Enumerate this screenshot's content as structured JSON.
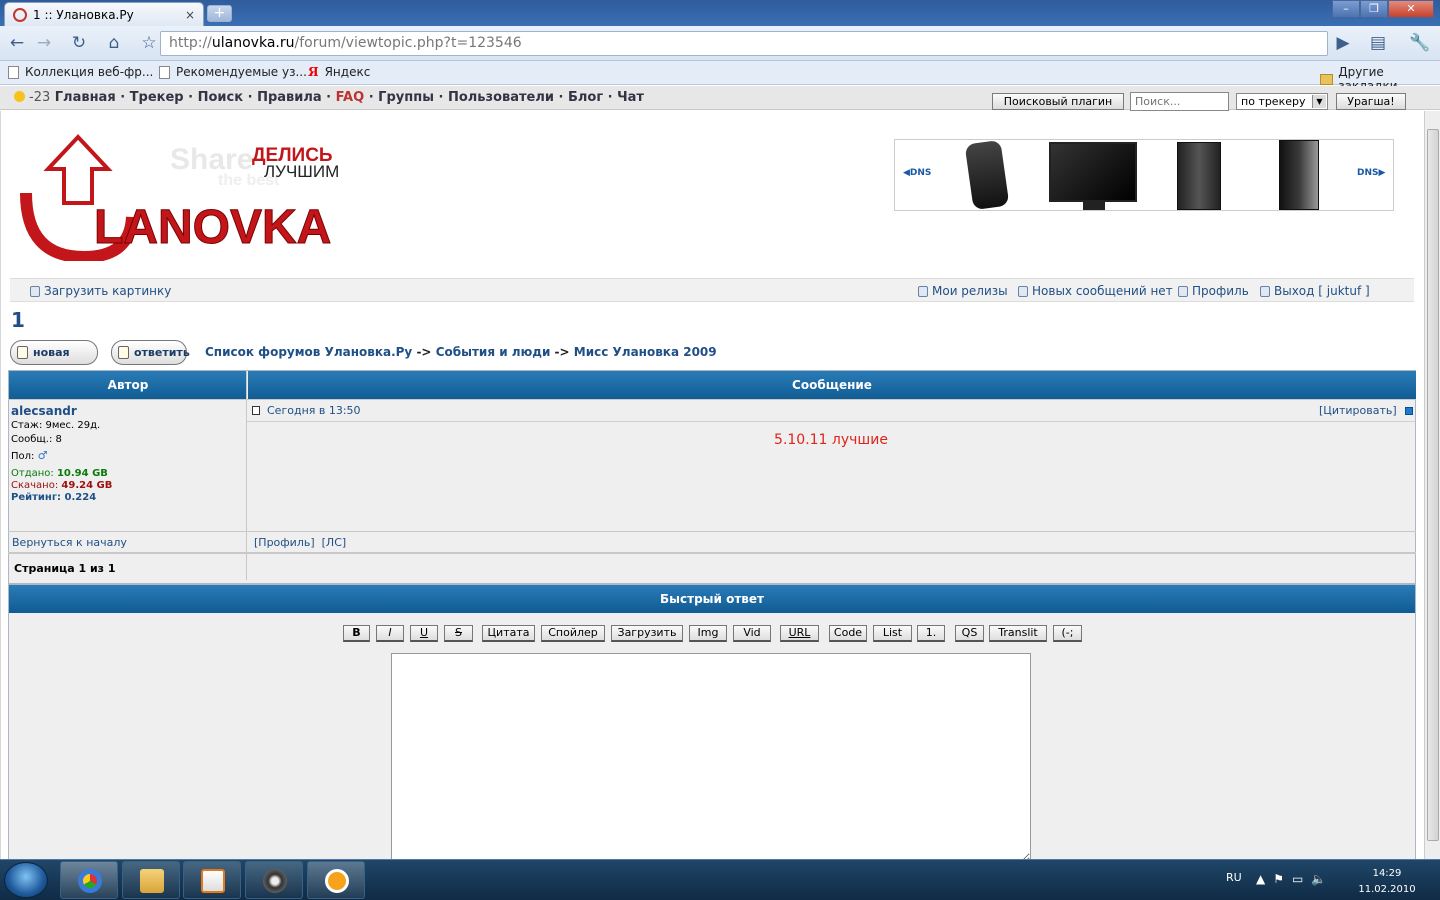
{
  "browser": {
    "tab_title": "1 :: Улановка.Ру",
    "tab_close": "×",
    "new_tab": "+",
    "url_base": "http://",
    "url_domain": "ulanovka.ru",
    "url_path": "/forum/viewtopic.php?t=123546",
    "bookmarks": [
      "Коллекция веб-фр...",
      "Рекомендуемые уз...",
      "Яндекс"
    ],
    "other_bookmarks": "Другие закладки"
  },
  "site_nav": {
    "temperature": "-23",
    "links": [
      "Главная",
      "Трекер",
      "Поиск",
      "Правила",
      "FAQ",
      "Группы",
      "Пользователи",
      "Блог",
      "Чат"
    ],
    "search_plugin_label": "Поисковый плагин",
    "search_placeholder": "Поиск...",
    "search_scope": "по трекеру",
    "search_button": "Урагша!"
  },
  "logo": {
    "tagline_top": "ДЕЛИСЬ",
    "tagline_bottom": "ЛУЧШИМ",
    "share_text": "Share",
    "share_sub": "the best",
    "brand_u": "U",
    "brand_rest": "LANOVKA"
  },
  "banner": {
    "brand": "DNS"
  },
  "user_bar": {
    "upload": "Загрузить картинку",
    "my_releases": "Мои релизы",
    "no_new_messages": "Новых сообщений нет",
    "profile": "Профиль",
    "logout": "Выход [ juktuf ]"
  },
  "topic": {
    "title": "1",
    "new_topic_btn": "новая тема",
    "reply_btn": "ответить",
    "breadcrumb": [
      "Список форумов Улановка.Ру",
      "События и люди",
      "Мисс Улановка 2009"
    ],
    "breadcrumb_sep": "->"
  },
  "table": {
    "col_author": "Автор",
    "col_message": "Сообщение"
  },
  "post": {
    "author": "alecsandr",
    "stazh": "Стаж: 9мес. 29д.",
    "messages": "Сообщ.: 8",
    "gender_label": "Пол:",
    "given_label": "Отдано:",
    "given_value": "10.94 GB",
    "downloaded_label": "Скачано:",
    "downloaded_value": "49.24 GB",
    "rating": "Рейтинг: 0.224",
    "date": "Сегодня в 13:50",
    "quote": "[Цитировать]",
    "text": "5.10.11 лучшие",
    "back_to_top": "Вернуться к началу",
    "profile_link": "[Профиль]",
    "pm_link": "[ЛС]"
  },
  "pagination": "Страница 1 из 1",
  "quick_reply": {
    "title": "Быстрый ответ",
    "buttons": [
      "B",
      "I",
      "U",
      "S",
      "Цитата",
      "Спойлер",
      "Загрузить",
      "Img",
      "Vid",
      "URL",
      "Code",
      "List",
      "1.",
      "QS",
      "Translit",
      "(-;"
    ]
  },
  "taskbar": {
    "lang": "RU",
    "time": "14:29",
    "date": "11.02.2010"
  },
  "colors": {
    "header_blue": "#1a6aa5",
    "link_blue": "#1f4f86",
    "post_red": "#e0241b",
    "given_green": "#0a7a0a",
    "downloaded_red": "#a01010"
  }
}
